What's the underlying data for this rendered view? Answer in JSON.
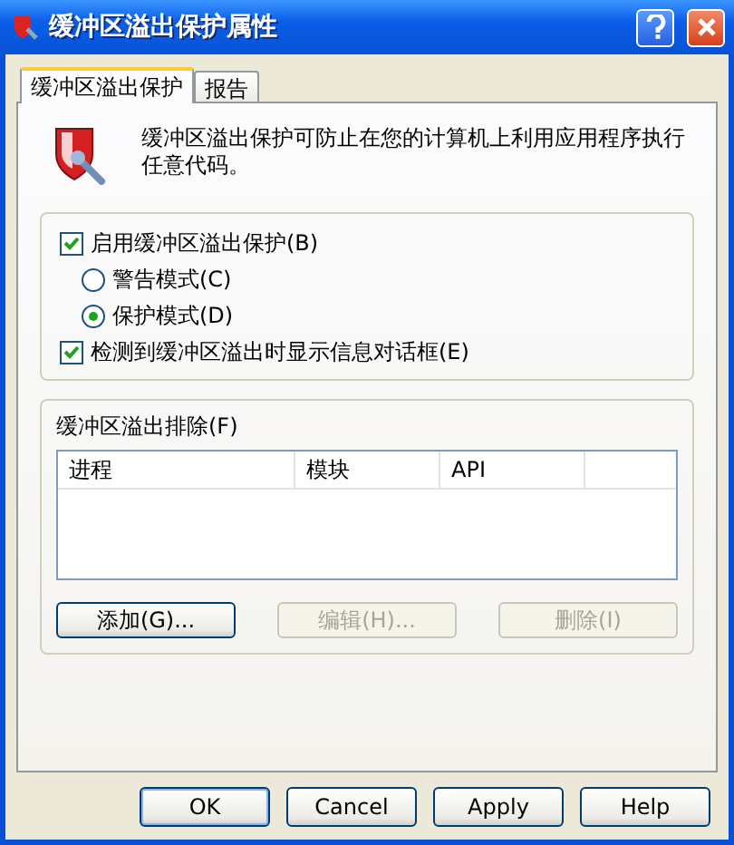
{
  "window": {
    "title": "缓冲区溢出保护属性"
  },
  "tabs": [
    {
      "label": "缓冲区溢出保护",
      "selected": true
    },
    {
      "label": "报告",
      "selected": false
    }
  ],
  "description": "缓冲区溢出保护可防止在您的计算机上利用应用程序执行任意代码。",
  "options": [
    {
      "kind": "checkbox",
      "label": "启用缓冲区溢出保护(B)",
      "checked": true
    },
    {
      "kind": "radio",
      "label": "警告模式(C)",
      "selected": false
    },
    {
      "kind": "radio",
      "label": "保护模式(D)",
      "selected": true
    },
    {
      "kind": "checkbox",
      "label": "检测到缓冲区溢出时显示信息对话框(E)",
      "checked": true
    }
  ],
  "exclusions": {
    "label": "缓冲区溢出排除(F)",
    "columns": [
      "进程",
      "模块",
      "API"
    ],
    "buttons": [
      {
        "label": "添加(G)...",
        "disabled": false
      },
      {
        "label": "编辑(H)...",
        "disabled": true
      },
      {
        "label": "删除(I)",
        "disabled": true
      }
    ]
  },
  "buttons": [
    {
      "label": "OK",
      "default": true
    },
    {
      "label": "Cancel",
      "default": false
    },
    {
      "label": "Apply",
      "default": false
    },
    {
      "label": "Help",
      "default": false
    }
  ]
}
